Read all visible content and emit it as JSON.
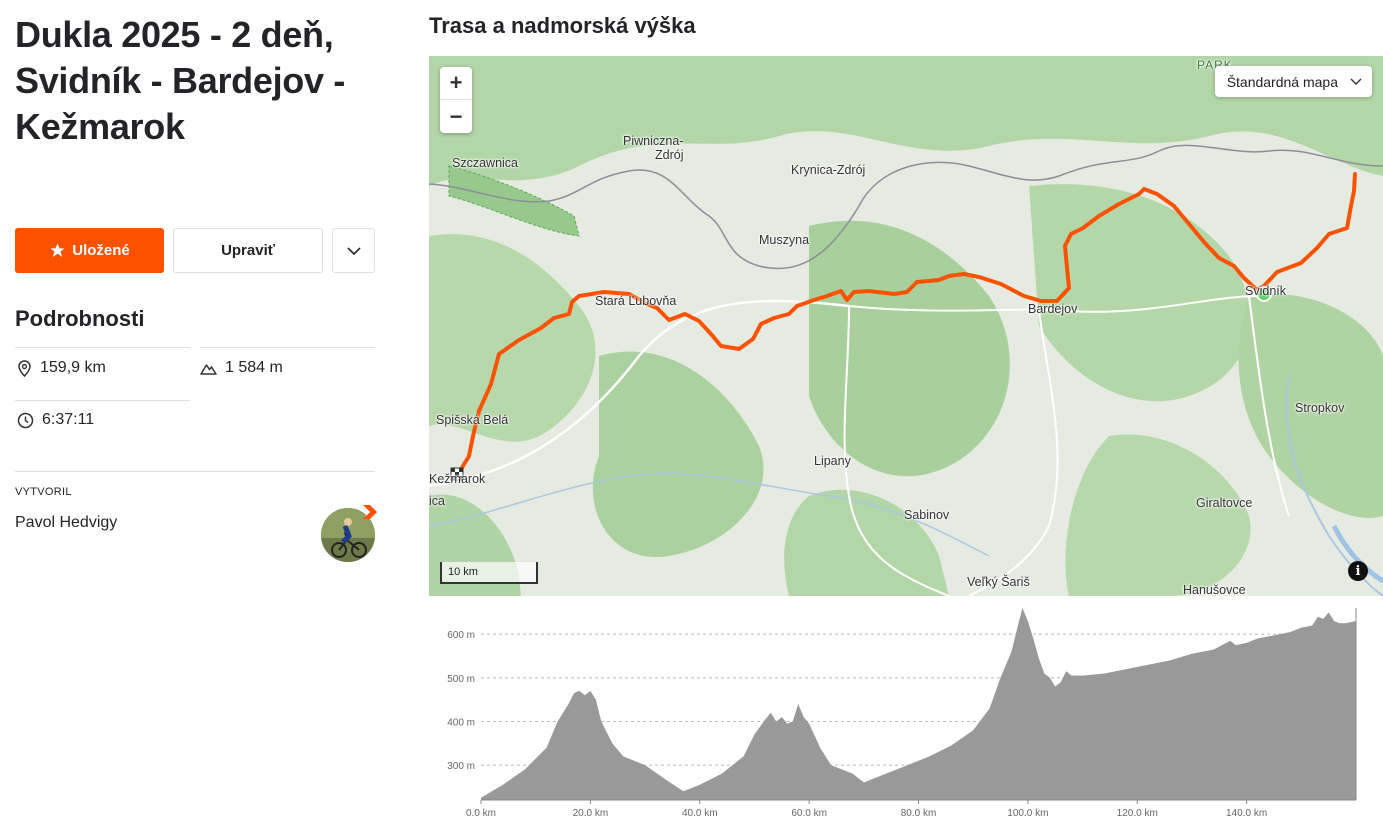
{
  "route": {
    "title": "Dukla 2025 - 2 deň, Svidník - Bardejov - Kežmarok"
  },
  "actions": {
    "saved_label": "Uložené",
    "edit_label": "Upraviť"
  },
  "details": {
    "heading": "Podrobnosti",
    "distance": "159,9 km",
    "elevation_gain": "1 584 m",
    "time": "6:37:11"
  },
  "creator": {
    "label": "VYTVORIL",
    "name": "Pavol Hedvigy"
  },
  "map": {
    "heading": "Trasa a nadmorská výška",
    "map_type": "Štandardná mapa",
    "zoom_in": "+",
    "zoom_out": "−",
    "scale_label": "10 km",
    "info": "i",
    "route_color": "#fc5200",
    "places": [
      "Szczawnica",
      "Piwniczna-",
      "Zdrój",
      "Krynica-Zdrój",
      "Muszyna",
      "Stará Ľubovňa",
      "Bardejov",
      "Svidník",
      "Stropkov",
      "Spišská Belá",
      "Kežmarok",
      "Lipany",
      "Sabinov",
      "Giraltovce",
      "Veľký Šariš",
      "Hanušovce",
      "PARK",
      "ica"
    ]
  },
  "chart_data": {
    "type": "area",
    "title": "",
    "xlabel": "",
    "ylabel": "",
    "x_ticks": [
      "0.0 km",
      "20.0 km",
      "40.0 km",
      "60.0 km",
      "80.0 km",
      "100.0 km",
      "120.0 km",
      "140.0 km"
    ],
    "y_ticks": [
      "300 m",
      "400 m",
      "500 m",
      "600 m"
    ],
    "xlim": [
      0,
      160
    ],
    "ylim": [
      220,
      660
    ],
    "fill_color": "#999999",
    "x": [
      0,
      4,
      8,
      12,
      14,
      16,
      17,
      18,
      19,
      20,
      21,
      22,
      24,
      26,
      30,
      34,
      37,
      40,
      44,
      48,
      50,
      52,
      53,
      54,
      55,
      56,
      57,
      58,
      59,
      60,
      62,
      64,
      68,
      70,
      74,
      78,
      82,
      86,
      90,
      93,
      95,
      97,
      98,
      99,
      100,
      101,
      102,
      103,
      104,
      105,
      106,
      107,
      108,
      110,
      114,
      118,
      122,
      126,
      130,
      134,
      137,
      138,
      140,
      142,
      144,
      146,
      148,
      150,
      152,
      153,
      154,
      155,
      156,
      157,
      158,
      160
    ],
    "values": [
      225,
      255,
      290,
      340,
      400,
      440,
      465,
      470,
      460,
      470,
      450,
      400,
      350,
      320,
      300,
      265,
      240,
      255,
      280,
      320,
      370,
      405,
      420,
      400,
      410,
      395,
      400,
      440,
      410,
      395,
      340,
      300,
      280,
      260,
      280,
      300,
      320,
      345,
      380,
      430,
      500,
      560,
      610,
      660,
      630,
      590,
      545,
      510,
      500,
      480,
      490,
      515,
      505,
      505,
      510,
      520,
      530,
      540,
      555,
      565,
      585,
      575,
      580,
      590,
      595,
      600,
      605,
      615,
      620,
      640,
      635,
      650,
      630,
      625,
      625,
      630
    ]
  }
}
